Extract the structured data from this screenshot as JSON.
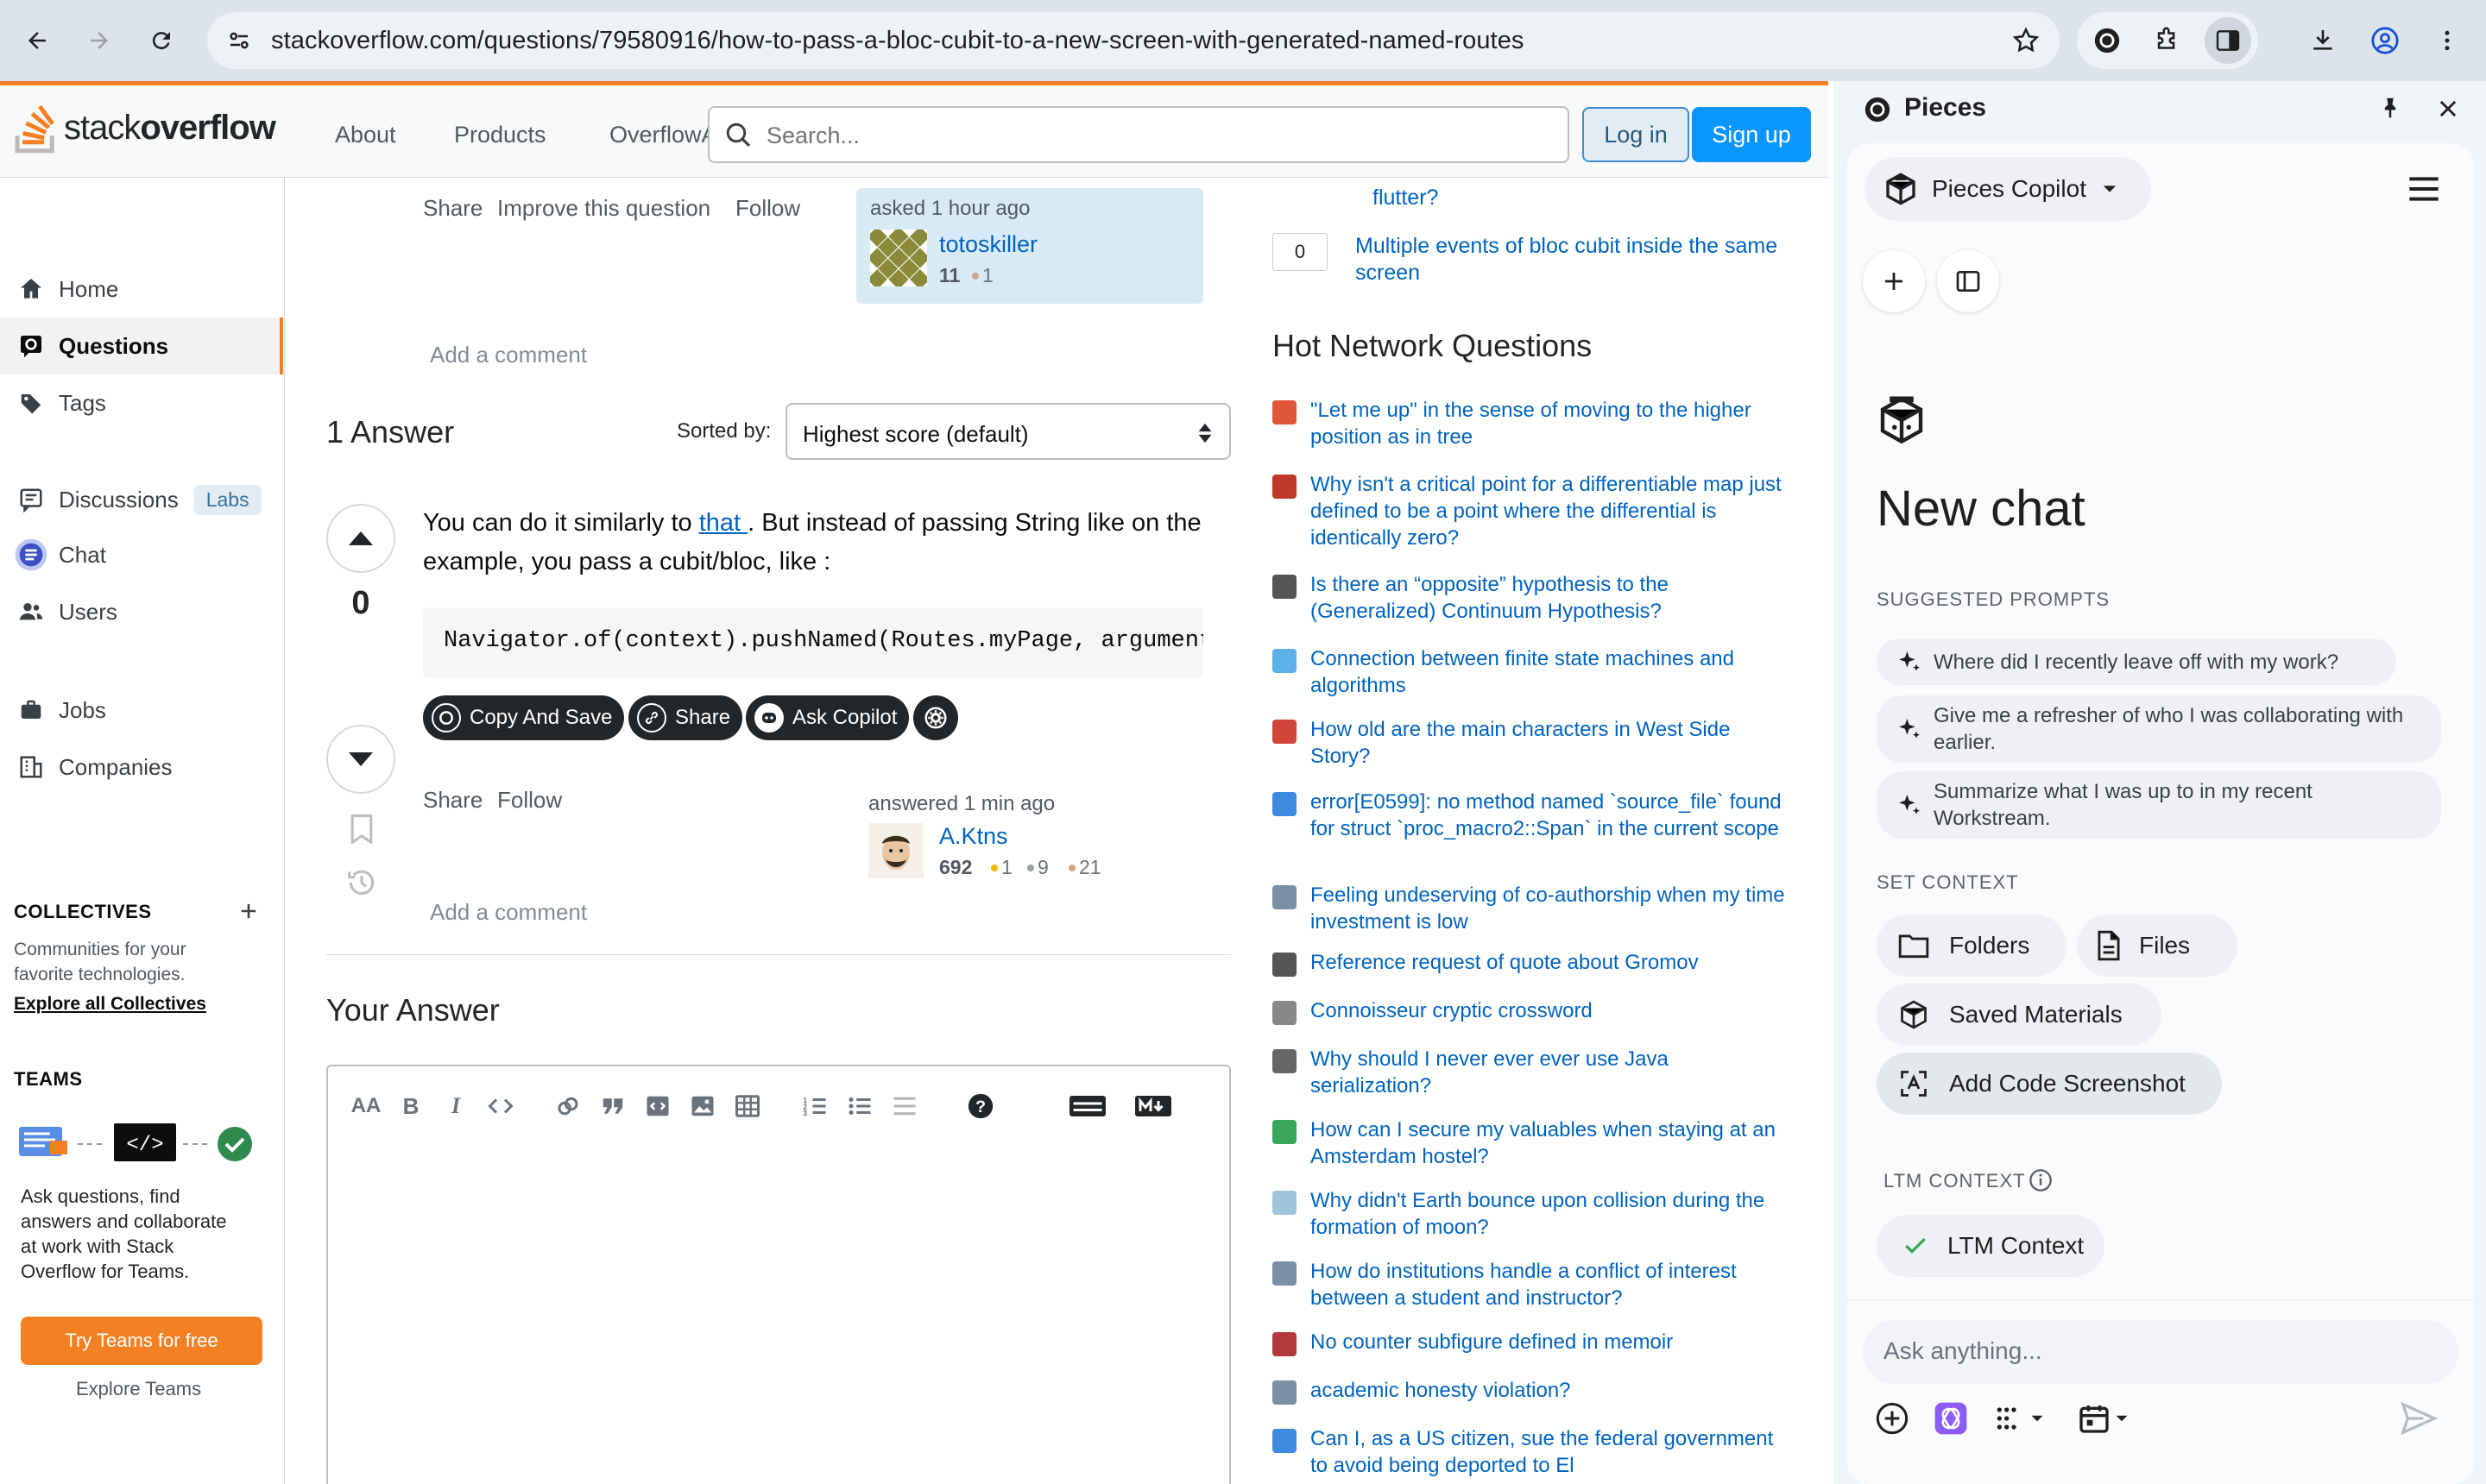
{
  "browser": {
    "url": "stackoverflow.com/questions/79580916/how-to-pass-a-bloc-cubit-to-a-new-screen-with-generated-named-routes"
  },
  "so": {
    "logo_light": "stack",
    "logo_bold": "overflow",
    "nav": [
      "About",
      "Products",
      "OverflowAI"
    ],
    "search_placeholder": "Search...",
    "login": "Log in",
    "signup": "Sign up"
  },
  "sidebar": {
    "home": "Home",
    "questions": "Questions",
    "tags": "Tags",
    "discussions": "Discussions",
    "labs": "Labs",
    "chat": "Chat",
    "users": "Users",
    "jobs": "Jobs",
    "companies": "Companies",
    "collectives_heading": "COLLECTIVES",
    "collectives_text_1": "Communities for your",
    "collectives_text_2": "favorite technologies.",
    "explore_collectives": "Explore all Collectives",
    "teams_heading": "TEAMS",
    "teams_text": [
      "Ask questions, find",
      "answers and collaborate",
      "at work with Stack",
      "Overflow for Teams."
    ],
    "try_teams": "Try Teams for free",
    "explore_teams": "Explore Teams"
  },
  "question": {
    "share": "Share",
    "improve": "Improve this question",
    "follow": "Follow",
    "asked": "asked 1 hour ago",
    "asker_name": "totoskiller",
    "asker_rep": "11",
    "asker_bronze": "1",
    "add_comment": "Add a comment"
  },
  "answers": {
    "heading": "1 Answer",
    "sorted_label": "Sorted by:",
    "sort_value": "Highest score (default)",
    "score": "0",
    "text_before": "You can do it similarly to ",
    "link": "that ",
    "text_after": ". But instead of passing String like on the example, you pass a cubit/bloc, like :",
    "code": "Navigator.of(context).pushNamed(Routes.myPage, arguments",
    "btn_copy": "Copy And Save",
    "btn_share": "Share",
    "btn_ask": "Ask Copilot",
    "share": "Share",
    "follow": "Follow",
    "answered": "answered 1 min ago",
    "answerer_name": "A.Ktns",
    "answerer_rep": "692",
    "gold": "1",
    "silver": "9",
    "bronze": "21",
    "add_comment": "Add a comment"
  },
  "your_answer": {
    "heading": "Your Answer"
  },
  "related": {
    "partial_link": "flutter?",
    "count": "0",
    "link": "Multiple events of bloc cubit inside the same screen"
  },
  "hnq": {
    "title": "Hot Network Questions",
    "items": [
      {
        "text": "\"Let me up\" in the sense of moving to the higher position as in tree",
        "icon_color": "#e0563a"
      },
      {
        "text": "Why isn't a critical point for a differentiable map just defined to be a point where the differential is identically zero?",
        "icon_color": "#c0392b"
      },
      {
        "text": "Is there an “opposite” hypothesis to the (Generalized) Continuum Hypothesis?",
        "icon_color": "#555555"
      },
      {
        "text": "Connection between finite state machines and algorithms",
        "icon_color": "#5eb1e6"
      },
      {
        "text": "How old are the main characters in West Side Story?",
        "icon_color": "#d0463a"
      },
      {
        "text": "error[E0599]: no method named `source_file` found for struct `proc_macro2::Span` in the current scope",
        "icon_color": "#3d8ae0"
      },
      {
        "text": "Feeling undeserving of co-authorship when my time investment is low",
        "icon_color": "#7a8fa6"
      },
      {
        "text": "Reference request of quote about Gromov",
        "icon_color": "#555555"
      },
      {
        "text": "Connoisseur cryptic crossword",
        "icon_color": "#888888"
      },
      {
        "text": "Why should I never ever ever use Java serialization?",
        "icon_color": "#666666"
      },
      {
        "text": "How can I secure my valuables when staying at an Amsterdam hostel?",
        "icon_color": "#3aa657"
      },
      {
        "text": "Why didn't Earth bounce upon collision during the formation of moon?",
        "icon_color": "#9ec5dc"
      },
      {
        "text": "How do institutions handle a conflict of interest between a student and instructor?",
        "icon_color": "#7a8fa6"
      },
      {
        "text": "No counter subfigure defined in memoir",
        "icon_color": "#b33a3a"
      },
      {
        "text": "academic honesty violation?",
        "icon_color": "#7a8fa6"
      },
      {
        "text": "Can I, as a US citizen, sue the federal government to avoid being deported to El",
        "icon_color": "#3d8ae0"
      }
    ]
  },
  "pieces": {
    "title": "Pieces",
    "copilot": "Pieces Copilot",
    "new_chat": "New chat",
    "suggested_label": "SUGGESTED PROMPTS",
    "prompts": [
      "Where did I recently leave off with my work?",
      "Give me a refresher of who I was collaborating with earlier.",
      "Summarize what I was up to in my recent Workstream."
    ],
    "set_context_label": "SET CONTEXT",
    "folders": "Folders",
    "files": "Files",
    "saved_materials": "Saved Materials",
    "add_code_screenshot": "Add Code Screenshot",
    "ltm_label": "LTM CONTEXT",
    "ltm_chip": "LTM Context",
    "ask_placeholder": "Ask anything..."
  },
  "colors": {
    "so_orange": "#f48024",
    "so_blue": "#0a95ff",
    "link": "#0063bf",
    "pieces_bg": "#f1f4f9"
  }
}
